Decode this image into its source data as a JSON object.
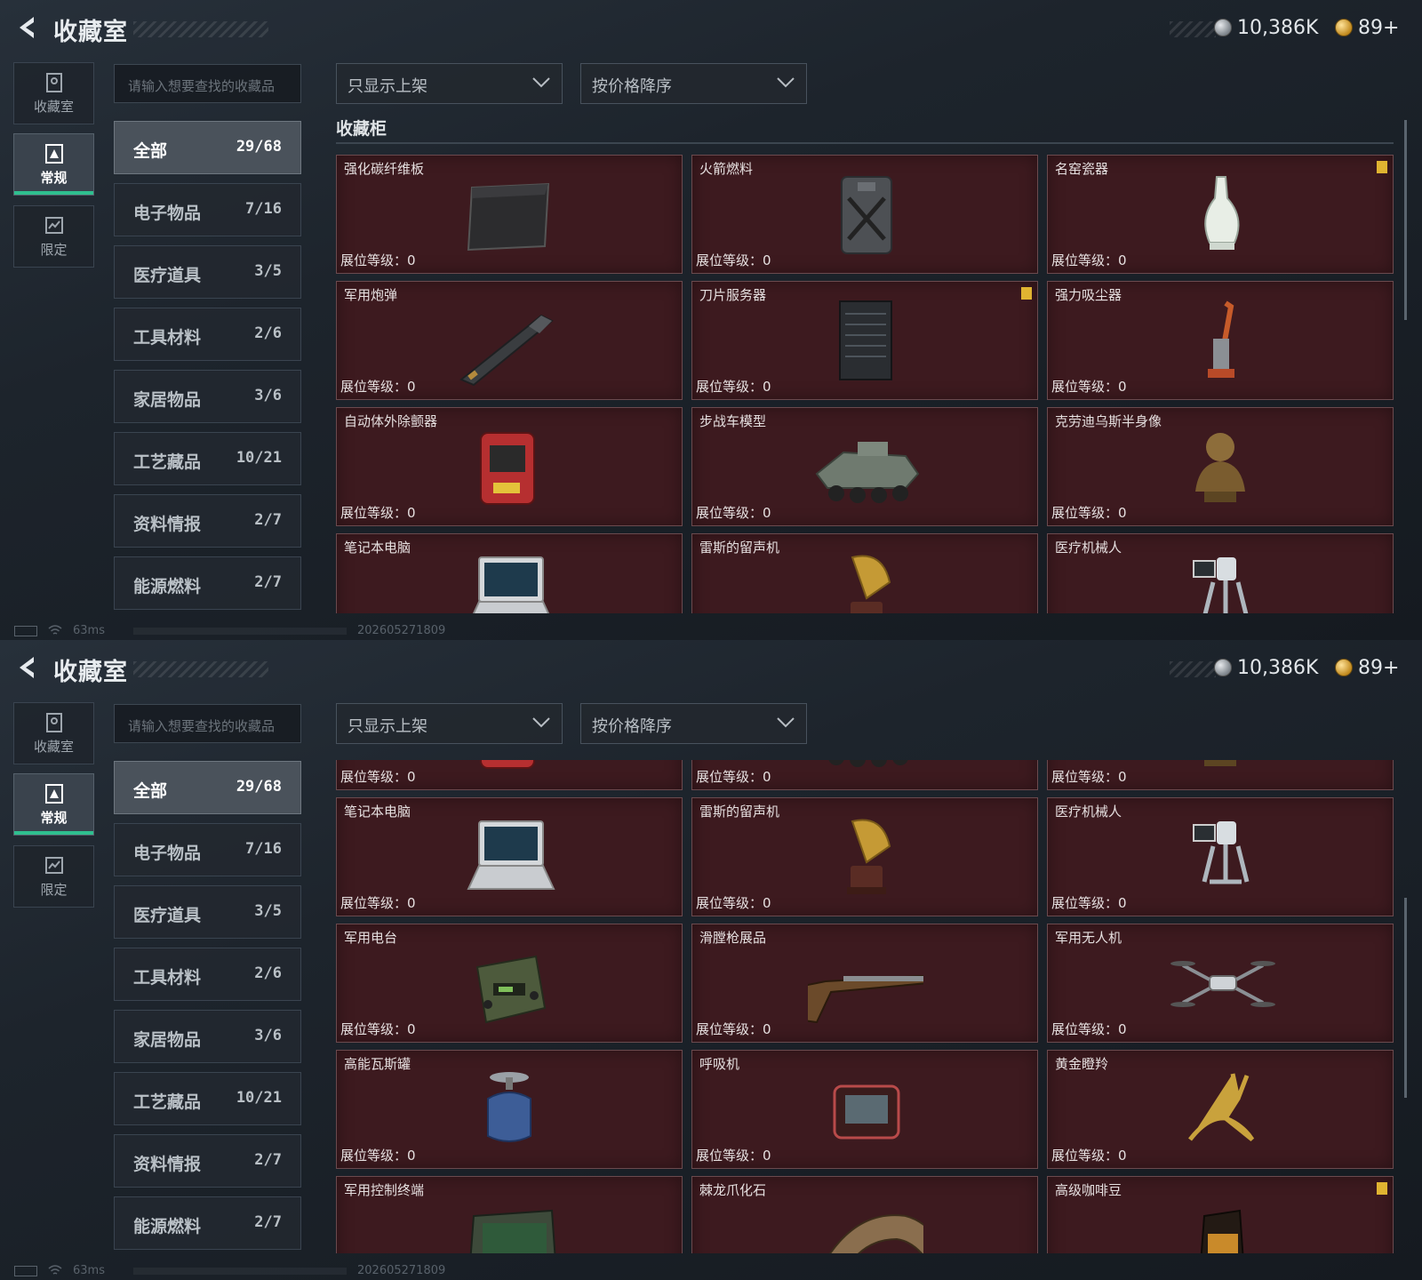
{
  "header": {
    "title": "收藏室",
    "currency_silver": "10,386K",
    "currency_gold": "89+"
  },
  "side_tabs": [
    {
      "label": "收藏室",
      "icon": "trophy-icon"
    },
    {
      "label": "常规",
      "icon": "regular-icon"
    },
    {
      "label": "限定",
      "icon": "limited-icon"
    }
  ],
  "search": {
    "placeholder": "请输入想要查找的收藏品"
  },
  "filters": {
    "show_filter": "只显示上架",
    "sort": "按价格降序"
  },
  "categories": [
    {
      "name": "全部",
      "count": "29/68"
    },
    {
      "name": "电子物品",
      "count": "7/16"
    },
    {
      "name": "医疗道具",
      "count": "3/5"
    },
    {
      "name": "工具材料",
      "count": "2/6"
    },
    {
      "name": "家居物品",
      "count": "3/6"
    },
    {
      "name": "工艺藏品",
      "count": "10/21"
    },
    {
      "name": "资料情报",
      "count": "2/7"
    },
    {
      "name": "能源燃料",
      "count": "2/7"
    }
  ],
  "section_title": "收藏柜",
  "level_label": "展位等级：0",
  "items_view1": [
    {
      "name": "强化碳纤维板",
      "icon": "carbon-fiber-plate-icon",
      "flag": false
    },
    {
      "name": "火箭燃料",
      "icon": "rocket-fuel-can-icon",
      "flag": false
    },
    {
      "name": "名窑瓷器",
      "icon": "porcelain-vase-icon",
      "flag": true
    },
    {
      "name": "军用炮弹",
      "icon": "artillery-shell-icon",
      "flag": false
    },
    {
      "name": "刀片服务器",
      "icon": "blade-server-icon",
      "flag": true
    },
    {
      "name": "强力吸尘器",
      "icon": "vacuum-cleaner-icon",
      "flag": false
    },
    {
      "name": "自动体外除颤器",
      "icon": "defibrillator-icon",
      "flag": false
    },
    {
      "name": "步战车模型",
      "icon": "ifv-model-icon",
      "flag": false
    },
    {
      "name": "克劳迪乌斯半身像",
      "icon": "bust-statue-icon",
      "flag": false
    },
    {
      "name": "笔记本电脑",
      "icon": "laptop-icon",
      "flag": false
    },
    {
      "name": "雷斯的留声机",
      "icon": "gramophone-icon",
      "flag": false
    },
    {
      "name": "医疗机械人",
      "icon": "medical-robot-icon",
      "flag": false
    }
  ],
  "items_view2": [
    {
      "name": "",
      "icon": "defibrillator-icon",
      "flag": false
    },
    {
      "name": "",
      "icon": "ifv-model-icon",
      "flag": false
    },
    {
      "name": "",
      "icon": "bust-statue-icon",
      "flag": false
    },
    {
      "name": "笔记本电脑",
      "icon": "laptop-icon",
      "flag": false
    },
    {
      "name": "雷斯的留声机",
      "icon": "gramophone-icon",
      "flag": false
    },
    {
      "name": "医疗机械人",
      "icon": "medical-robot-icon",
      "flag": false
    },
    {
      "name": "军用电台",
      "icon": "military-radio-icon",
      "flag": false
    },
    {
      "name": "滑膛枪展品",
      "icon": "musket-icon",
      "flag": false
    },
    {
      "name": "军用无人机",
      "icon": "drone-icon",
      "flag": false
    },
    {
      "name": "高能瓦斯罐",
      "icon": "gas-canister-icon",
      "flag": false
    },
    {
      "name": "呼吸机",
      "icon": "ventilator-icon",
      "flag": false
    },
    {
      "name": "黄金瞪羚",
      "icon": "golden-gazelle-icon",
      "flag": false
    },
    {
      "name": "军用控制终端",
      "icon": "control-terminal-icon",
      "flag": false
    },
    {
      "name": "棘龙爪化石",
      "icon": "claw-fossil-icon",
      "flag": false
    },
    {
      "name": "高级咖啡豆",
      "icon": "coffee-beans-icon",
      "flag": true
    }
  ],
  "status": {
    "latency": "63ms",
    "timestamp": "202605271809"
  },
  "colors": {
    "accent": "#2fbf8f",
    "cell_bg": "#3d1a1f",
    "flag": "#e0b431"
  }
}
